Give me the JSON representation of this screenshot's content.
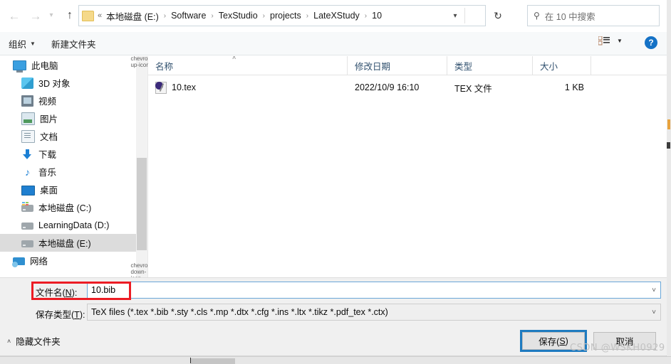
{
  "navbar": {
    "back_icon": "arrow-left-icon",
    "forward_icon": "arrow-right-icon",
    "recent_icon": "chevron-down-icon",
    "up_icon": "arrow-up-icon",
    "refresh_icon": "refresh-icon",
    "folder_icon": "folder-icon",
    "crumb_prefix": "«",
    "breadcrumbs": [
      "本地磁盘 (E:)",
      "Software",
      "TexStudio",
      "projects",
      "LateXStudy",
      "10"
    ],
    "separator": "›",
    "dropdown_icon": "chevron-down-icon",
    "search": {
      "icon": "search-icon",
      "placeholder": "在 10 中搜索",
      "value": ""
    }
  },
  "commandbar": {
    "organize_label": "组织",
    "organize_caret": "▼",
    "new_folder_label": "新建文件夹",
    "view_icon": "view-options-icon",
    "view_caret": "▼",
    "help_label": "?"
  },
  "sidebar": {
    "items": [
      {
        "label": "此电脑",
        "icon": "computer-icon",
        "indent": false,
        "selected": false
      },
      {
        "label": "3D 对象",
        "icon": "3d-objects-icon",
        "indent": true,
        "selected": false
      },
      {
        "label": "视频",
        "icon": "videos-icon",
        "indent": true,
        "selected": false
      },
      {
        "label": "图片",
        "icon": "pictures-icon",
        "indent": true,
        "selected": false
      },
      {
        "label": "文档",
        "icon": "documents-icon",
        "indent": true,
        "selected": false
      },
      {
        "label": "下载",
        "icon": "downloads-icon",
        "indent": true,
        "selected": false
      },
      {
        "label": "音乐",
        "icon": "music-icon",
        "indent": true,
        "selected": false
      },
      {
        "label": "桌面",
        "icon": "desktop-icon",
        "indent": true,
        "selected": false
      },
      {
        "label": "本地磁盘 (C:)",
        "icon": "system-drive-icon",
        "indent": true,
        "selected": false
      },
      {
        "label": "LearningData (D:)",
        "icon": "drive-icon",
        "indent": true,
        "selected": false
      },
      {
        "label": "本地磁盘 (E:)",
        "icon": "drive-icon",
        "indent": true,
        "selected": true
      },
      {
        "label": "网络",
        "icon": "network-icon",
        "indent": false,
        "selected": false
      }
    ],
    "scroll_up_icon": "chevron-up-icon",
    "scroll_down_icon": "chevron-down-icon"
  },
  "filelist": {
    "columns": [
      "名称",
      "修改日期",
      "类型",
      "大小"
    ],
    "sort_indicator": "˄",
    "rows": [
      {
        "name": "10.tex",
        "icon": "tex-document-icon",
        "date": "2022/10/9 16:10",
        "type": "TEX 文件",
        "size": "1 KB"
      }
    ]
  },
  "form": {
    "filename_label_pre": "文件名(",
    "filename_label_key": "N",
    "filename_label_post": "):",
    "filename_value": "10.bib",
    "filename_caret": "˅",
    "savetype_label_pre": "保存类型(",
    "savetype_label_key": "T",
    "savetype_label_post": "):",
    "savetype_value": "TeX files (*.tex *.bib *.sty *.cls *.mp *.dtx *.cfg *.ins *.ltx *.tikz *.pdf_tex *.ctx)",
    "savetype_caret": "˅",
    "annotation_color": "#ec1c24"
  },
  "footer": {
    "hide_folders_caret": "˄",
    "hide_folders_label": "隐藏文件夹",
    "save_label_pre": "保存(",
    "save_label_key": "S",
    "save_label_post": ")",
    "cancel_label": "取消",
    "focus_color": "#1e7bc0",
    "watermark": "CSDN @WSKH0929"
  }
}
